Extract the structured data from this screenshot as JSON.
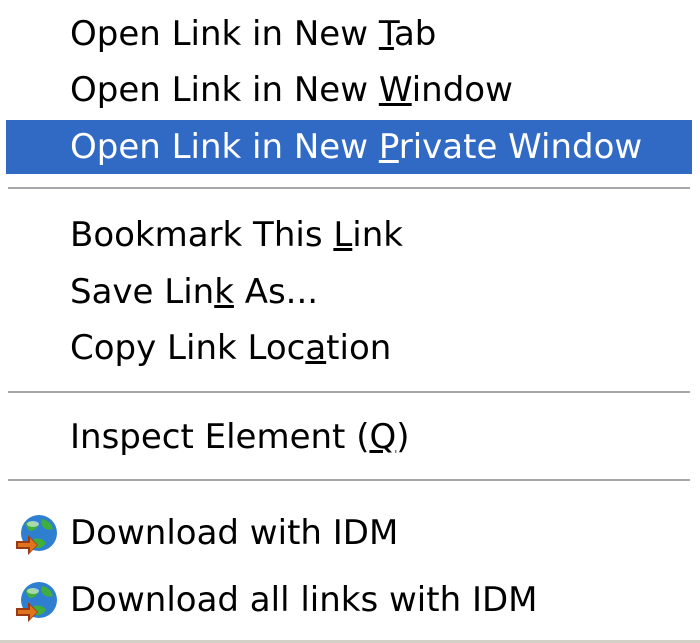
{
  "context_menu": {
    "items": [
      {
        "label": "Open Link in New Tab",
        "shortcut_letter": "T"
      },
      {
        "label": "Open Link in New Window",
        "shortcut_letter": "W"
      },
      {
        "label": "Open Link in New Private Window",
        "shortcut_letter": "P",
        "highlighted": true
      },
      {
        "label": "Bookmark This Link",
        "shortcut_letter": "L"
      },
      {
        "label": "Save Link As...",
        "shortcut_letter": "k"
      },
      {
        "label": "Copy Link Location",
        "shortcut_letter": "a"
      },
      {
        "label": "Inspect Element (Q)",
        "shortcut_letter": "Q"
      },
      {
        "label": "Download with IDM",
        "icon": "idm-globe-icon"
      },
      {
        "label": "Download all links with IDM",
        "icon": "idm-globe-icon"
      }
    ],
    "colors": {
      "highlight": "#316ac5",
      "highlight_text": "#ffffff",
      "text": "#000000",
      "separator": "#a7a6aa",
      "background": "#ffffff"
    }
  }
}
